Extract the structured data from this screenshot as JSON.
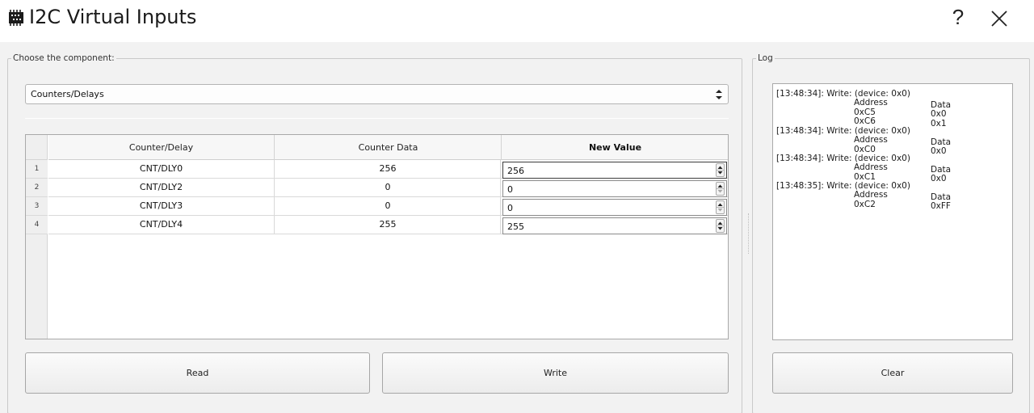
{
  "window": {
    "title": "I2C Virtual Inputs",
    "help_label": "?",
    "close_icon": "close-icon"
  },
  "component_group": {
    "legend": "Choose the component:",
    "selected": "Counters/Delays"
  },
  "table": {
    "columns": [
      "Counter/Delay",
      "Counter Data",
      "New Value"
    ],
    "rows": [
      {
        "row_header": "1",
        "name": "CNT/DLY0",
        "data": "256",
        "new_value": "256"
      },
      {
        "row_header": "2",
        "name": "CNT/DLY2",
        "data": "0",
        "new_value": "0"
      },
      {
        "row_header": "3",
        "name": "CNT/DLY3",
        "data": "0",
        "new_value": "0"
      },
      {
        "row_header": "4",
        "name": "CNT/DLY4",
        "data": "255",
        "new_value": "255"
      }
    ]
  },
  "buttons": {
    "read": "Read",
    "write": "Write",
    "clear": "Clear"
  },
  "log_group": {
    "legend": "Log",
    "entries": [
      {
        "header": "[13:48:34]: Write: (device: 0x0)",
        "col1": "Address",
        "col2": "Data",
        "rows": [
          [
            "0xC5",
            "0x0"
          ],
          [
            "0xC6",
            "0x1"
          ]
        ]
      },
      {
        "header": "[13:48:34]: Write: (device: 0x0)",
        "col1": "Address",
        "col2": "Data",
        "rows": [
          [
            "0xC0",
            "0x0"
          ]
        ]
      },
      {
        "header": "[13:48:34]: Write: (device: 0x0)",
        "col1": "Address",
        "col2": "Data",
        "rows": [
          [
            "0xC1",
            "0x0"
          ]
        ]
      },
      {
        "header": "[13:48:35]: Write: (device: 0x0)",
        "col1": "Address",
        "col2": "Data",
        "rows": [
          [
            "0xC2",
            "0xFF"
          ]
        ]
      }
    ]
  }
}
